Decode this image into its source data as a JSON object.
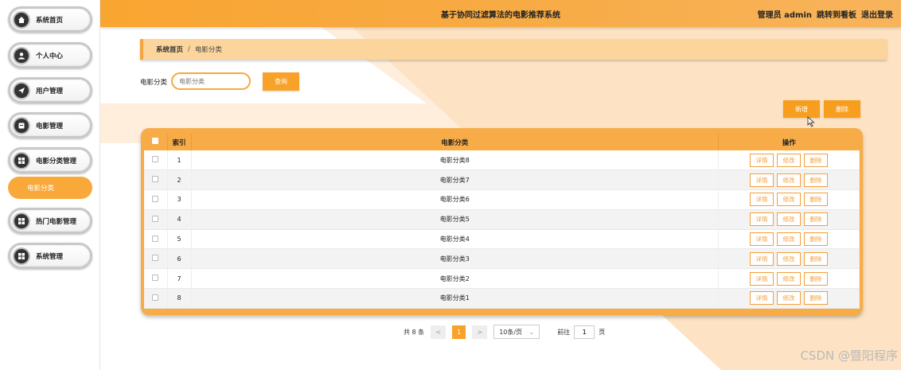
{
  "header": {
    "title": "基于协同过滤算法的电影推荐系统",
    "admin_label": "管理员 admin",
    "dashboard_link": "跳转到看板",
    "logout_link": "退出登录"
  },
  "sidebar": {
    "items": [
      {
        "label": "系统首页",
        "icon": "home-icon"
      },
      {
        "label": "个人中心",
        "icon": "user-icon"
      },
      {
        "label": "用户管理",
        "icon": "send-icon"
      },
      {
        "label": "电影管理",
        "icon": "film-icon"
      },
      {
        "label": "电影分类管理",
        "icon": "grid-icon"
      },
      {
        "label": "热门电影管理",
        "icon": "grid-icon"
      },
      {
        "label": "系统管理",
        "icon": "grid-icon"
      }
    ],
    "active_sub": "电影分类"
  },
  "breadcrumb": {
    "home": "系统首页",
    "sep": "/",
    "current": "电影分类"
  },
  "search": {
    "label": "电影分类",
    "placeholder": "电影分类",
    "button": "查询"
  },
  "actions": {
    "add": "新增",
    "delete": "删除"
  },
  "table": {
    "headers": {
      "index": "索引",
      "category": "电影分类",
      "ops": "操作"
    },
    "rows": [
      {
        "index": "1",
        "category": "电影分类8"
      },
      {
        "index": "2",
        "category": "电影分类7"
      },
      {
        "index": "3",
        "category": "电影分类6"
      },
      {
        "index": "4",
        "category": "电影分类5"
      },
      {
        "index": "5",
        "category": "电影分类4"
      },
      {
        "index": "6",
        "category": "电影分类3"
      },
      {
        "index": "7",
        "category": "电影分类2"
      },
      {
        "index": "8",
        "category": "电影分类1"
      }
    ],
    "row_ops": {
      "detail": "详情",
      "edit": "修改",
      "delete": "删除"
    }
  },
  "pagination": {
    "total": "共 8 条",
    "prev": "<",
    "current": "1",
    "next": ">",
    "page_size": "10条/页",
    "goto_label": "前往",
    "goto_value": "1",
    "page_suffix": "页"
  },
  "watermark": "CSDN @暨阳程序",
  "colors": {
    "accent": "#f8a22a",
    "header_bg": "#f9a531",
    "breadcrumb_bg": "#fbd59c"
  }
}
